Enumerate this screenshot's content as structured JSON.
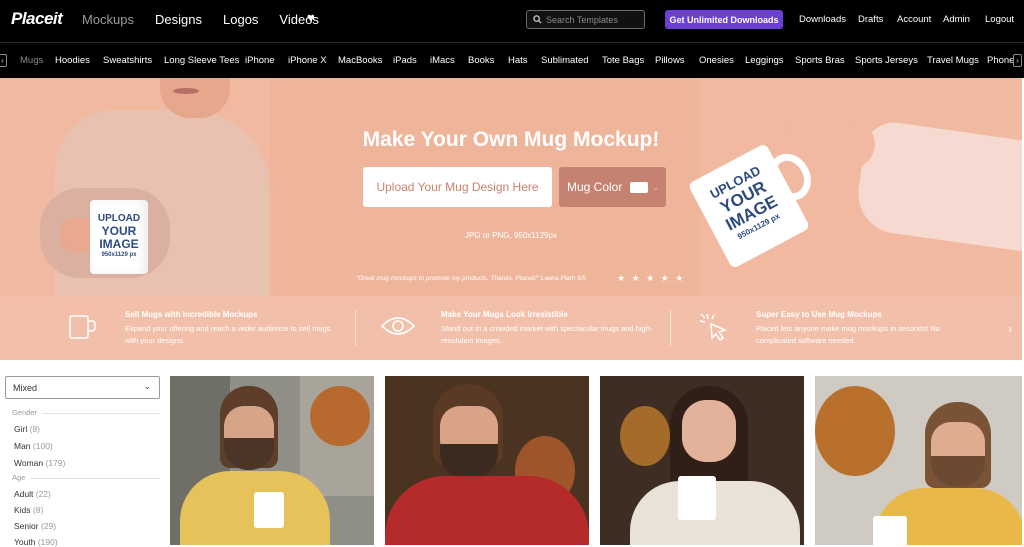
{
  "topnav": {
    "logo": "Placeit",
    "main_links": [
      {
        "label": "Mockups",
        "dim": true
      },
      {
        "label": "Designs",
        "dim": false
      },
      {
        "label": "Logos",
        "dim": false
      },
      {
        "label": "Videos",
        "dim": false
      }
    ],
    "search_placeholder": "Search Templates",
    "unlimited_label": "Get Unlimited Downloads",
    "right_links": [
      "Downloads",
      "Drafts",
      "Account",
      "Admin",
      "Logout"
    ]
  },
  "categories": [
    "Mugs",
    "Hoodies",
    "Sweatshirts",
    "Long Sleeve Tees",
    "iPhone",
    "iPhone X",
    "MacBooks",
    "iPads",
    "iMacs",
    "Books",
    "Hats",
    "Sublimated",
    "Tote Bags",
    "Pillows",
    "Onesies",
    "Leggings",
    "Sports Bras",
    "Sports Jerseys",
    "Travel Mugs",
    "Phone"
  ],
  "hero": {
    "title": "Make Your Own Mug Mockup!",
    "upload_label": "Upload Your Mug Design Here",
    "mug_color_label": "Mug Color",
    "file_hint": "JPG or PNG, 950x1129px",
    "testimonial": "\"Great mug mockups to promote my products. Thanks, Placeit!\" Lawra Plath 5/5",
    "stars": "★ ★ ★ ★ ★",
    "mug_text": {
      "upload": "UPLOAD",
      "your": "YOUR",
      "image": "IMAGE",
      "size": "950x1129 px"
    }
  },
  "features": [
    {
      "title": "Sell Mugs with Incredible Mockups",
      "desc": "Expand your offering and reach a wider audience to sell mugs with your designs.",
      "icon": "mug-icon"
    },
    {
      "title": "Make Your Mugs Look Irresistible",
      "desc": "Stand out in a crowded market with spectacular mugs and high-resolution images.",
      "icon": "eye-icon"
    },
    {
      "title": "Super Easy to Use Mug Mockups",
      "desc": "Placeit lets anyone make mug mockups in seconds! No complicated software needed.",
      "icon": "cursor-click-icon"
    }
  ],
  "filters": {
    "sort_value": "Mixed",
    "groups": [
      {
        "heading": "Gender",
        "items": [
          {
            "label": "Girl",
            "count": "(8)"
          },
          {
            "label": "Man",
            "count": "(100)"
          },
          {
            "label": "Woman",
            "count": "(179)"
          }
        ]
      },
      {
        "heading": "Age",
        "items": [
          {
            "label": "Adult",
            "count": "(22)"
          },
          {
            "label": "Kids",
            "count": "(8)"
          },
          {
            "label": "Senior",
            "count": "(29)"
          },
          {
            "label": "Youth",
            "count": "(190)"
          }
        ]
      }
    ]
  },
  "colors": {
    "accent": "#6a3fd1",
    "hero_bg": "#f1b9a0",
    "features_bg": "#f2c0aa"
  }
}
